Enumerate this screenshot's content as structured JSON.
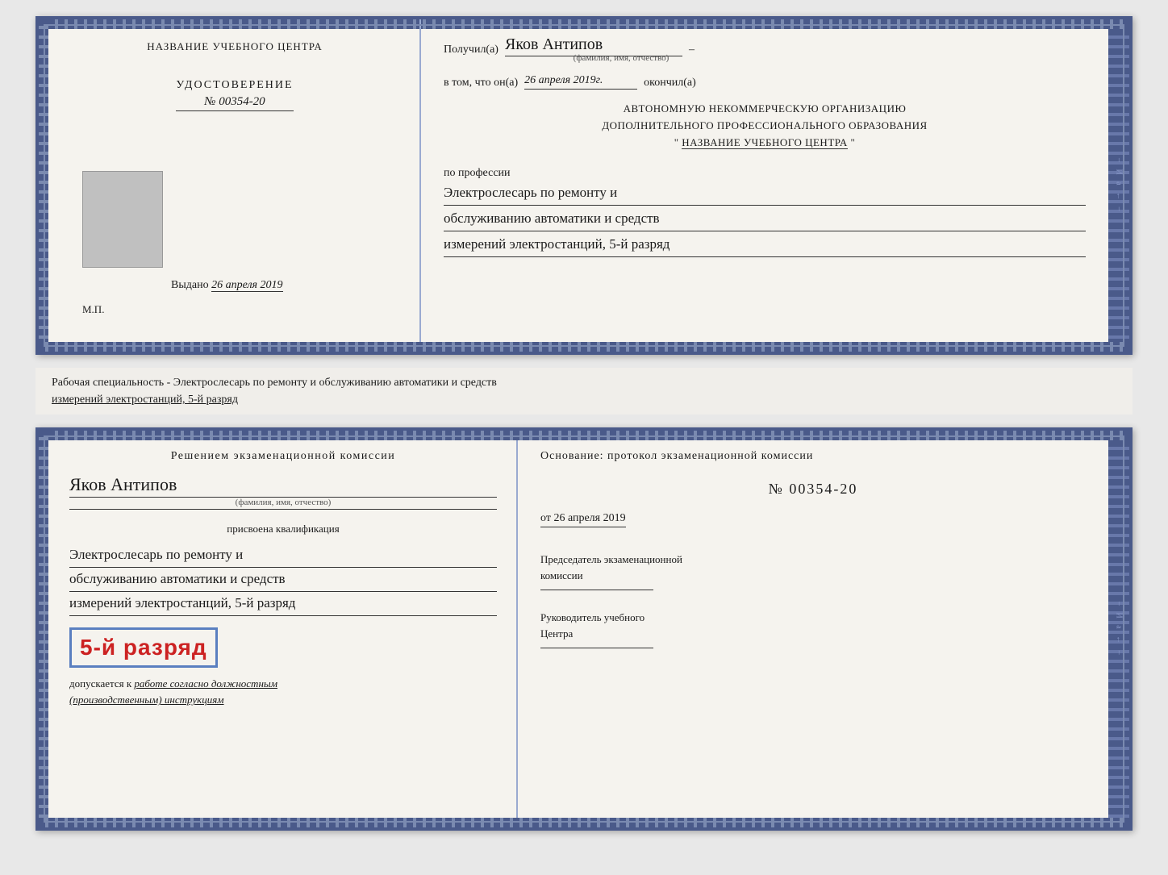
{
  "page": {
    "background_color": "#e8e8e8"
  },
  "top_doc": {
    "left": {
      "center_title": "НАЗВАНИЕ УЧЕБНОГО ЦЕНТРА",
      "udostoverenie_label": "УДОСТОВЕРЕНИЕ",
      "doc_number": "№ 00354-20",
      "vydano_label": "Выдано",
      "vydano_date": "26 апреля 2019",
      "mp_label": "М.П."
    },
    "right": {
      "poluchil_label": "Получил(а)",
      "recipient_name": "Яков Антипов",
      "recipient_dash": "–",
      "fio_subtitle": "(фамилия, имя, отчество)",
      "vtom_label": "в том, что он(а)",
      "vtom_date": "26 апреля 2019г.",
      "okonchil_label": "окончил(а)",
      "org_line1": "АВТОНОМНУЮ НЕКОММЕРЧЕСКУЮ ОРГАНИЗАЦИЮ",
      "org_line2": "ДОПОЛНИТЕЛЬНОГО ПРОФЕССИОНАЛЬНОГО ОБРАЗОВАНИЯ",
      "org_quote": "\"",
      "org_name": "НАЗВАНИЕ УЧЕБНОГО ЦЕНТРА",
      "org_quote2": "\"",
      "po_professii": "по профессии",
      "profession_line1": "Электрослесарь по ремонту и",
      "profession_line2": "обслуживанию автоматики и средств",
      "profession_line3": "измерений электростанций, 5-й разряд"
    }
  },
  "middle": {
    "text_line1": "Рабочая специальность - Электрослесарь по ремонту и обслуживанию автоматики и средств",
    "text_line2": "измерений электростанций, 5-й разряд"
  },
  "bottom_doc": {
    "left": {
      "resheniyem_label": "Решением экзаменационной комиссии",
      "name_cursive": "Яков Антипов",
      "fio_subtitle": "(фамилия, имя, отчество)",
      "prisvoena_label": "присвоена квалификация",
      "qual_line1": "Электрослесарь по ремонту и",
      "qual_line2": "обслуживанию автоматики и средств",
      "qual_line3": "измерений электростанций, 5-й разряд",
      "rank_badge": "5-й разряд",
      "dopuskaetsya_prefix": "допускается к",
      "dopuskaetsya_italic": "работе согласно должностным",
      "dopuskaetsya_italic2": "(производственным) инструкциям"
    },
    "right": {
      "osnovanie_label": "Основание: протокол экзаменационной комиссии",
      "protocol_number": "№ 00354-20",
      "ot_label": "от",
      "ot_date": "26 апреля 2019",
      "predsedatel_label": "Председатель экзаменационной",
      "predsedatel_label2": "комиссии",
      "rukovoditel_label": "Руководитель учебного",
      "rukovoditel_label2": "Центра"
    }
  },
  "side_chars": "ИаITo←–",
  "colors": {
    "border": "#4a5a8a",
    "accent": "#cc2222",
    "text": "#1a1a1a",
    "bg": "#f5f3ee"
  }
}
